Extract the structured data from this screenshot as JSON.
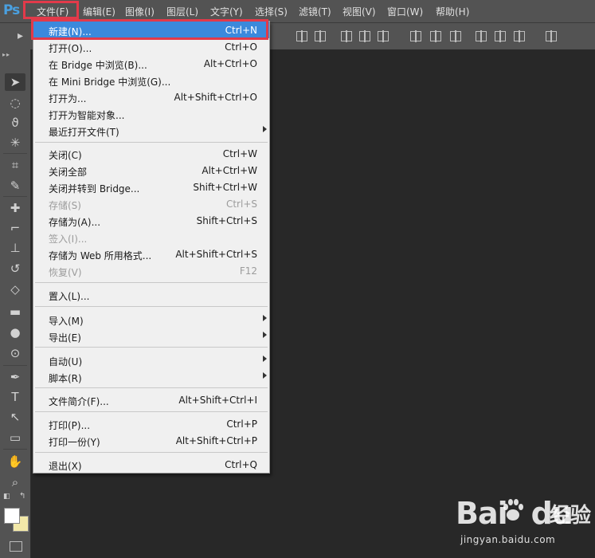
{
  "app": {
    "logo": "Ps"
  },
  "menubar": {
    "items": [
      {
        "label": "文件(F)"
      },
      {
        "label": "编辑(E)"
      },
      {
        "label": "图像(I)"
      },
      {
        "label": "图层(L)"
      },
      {
        "label": "文字(Y)"
      },
      {
        "label": "选择(S)"
      },
      {
        "label": "滤镜(T)"
      },
      {
        "label": "视图(V)"
      },
      {
        "label": "窗口(W)"
      },
      {
        "label": "帮助(H)"
      }
    ]
  },
  "file_menu": {
    "items": [
      {
        "label": "新建(N)...",
        "shortcut": "Ctrl+N",
        "highlighted": true
      },
      {
        "label": "打开(O)...",
        "shortcut": "Ctrl+O"
      },
      {
        "label": "在 Bridge 中浏览(B)...",
        "shortcut": "Alt+Ctrl+O"
      },
      {
        "label": "在 Mini Bridge 中浏览(G)...",
        "shortcut": ""
      },
      {
        "label": "打开为...",
        "shortcut": "Alt+Shift+Ctrl+O"
      },
      {
        "label": "打开为智能对象...",
        "shortcut": ""
      },
      {
        "label": "最近打开文件(T)",
        "shortcut": "",
        "submenu": true
      },
      {
        "label": "关闭(C)",
        "shortcut": "Ctrl+W"
      },
      {
        "label": "关闭全部",
        "shortcut": "Alt+Ctrl+W"
      },
      {
        "label": "关闭并转到 Bridge...",
        "shortcut": "Shift+Ctrl+W"
      },
      {
        "label": "存储(S)",
        "shortcut": "Ctrl+S",
        "disabled": true
      },
      {
        "label": "存储为(A)...",
        "shortcut": "Shift+Ctrl+S"
      },
      {
        "label": "签入(I)...",
        "shortcut": "",
        "disabled": true
      },
      {
        "label": "存储为 Web 所用格式...",
        "shortcut": "Alt+Shift+Ctrl+S"
      },
      {
        "label": "恢复(V)",
        "shortcut": "F12",
        "disabled": true
      },
      {
        "label": "置入(L)...",
        "shortcut": ""
      },
      {
        "label": "导入(M)",
        "shortcut": "",
        "submenu": true
      },
      {
        "label": "导出(E)",
        "shortcut": "",
        "submenu": true
      },
      {
        "label": "自动(U)",
        "shortcut": "",
        "submenu": true
      },
      {
        "label": "脚本(R)",
        "shortcut": "",
        "submenu": true
      },
      {
        "label": "文件简介(F)...",
        "shortcut": "Alt+Shift+Ctrl+I"
      },
      {
        "label": "打印(P)...",
        "shortcut": "Ctrl+P"
      },
      {
        "label": "打印一份(Y)",
        "shortcut": "Alt+Shift+Ctrl+P"
      },
      {
        "label": "退出(X)",
        "shortcut": "Ctrl+Q"
      }
    ]
  },
  "tools": [
    {
      "icon": "move-tool-icon"
    },
    {
      "icon": "elliptical-marquee-icon"
    },
    {
      "icon": "lasso-icon"
    },
    {
      "icon": "magic-wand-icon"
    },
    {
      "icon": "crop-icon"
    },
    {
      "icon": "eyedropper-icon"
    },
    {
      "icon": "healing-brush-icon"
    },
    {
      "icon": "brush-icon"
    },
    {
      "icon": "clone-stamp-icon"
    },
    {
      "icon": "history-brush-icon"
    },
    {
      "icon": "eraser-icon"
    },
    {
      "icon": "gradient-icon"
    },
    {
      "icon": "blur-icon"
    },
    {
      "icon": "dodge-icon"
    },
    {
      "icon": "pen-icon"
    },
    {
      "icon": "type-icon"
    },
    {
      "icon": "path-selection-icon"
    },
    {
      "icon": "rectangle-shape-icon"
    },
    {
      "icon": "hand-icon"
    },
    {
      "icon": "zoom-icon"
    }
  ],
  "colors": {
    "foreground": "#ffffff",
    "background": "#f2e8a8",
    "highlight": "#3b89dc",
    "annotation_red": "#e23a4a"
  },
  "watermark": {
    "brand": "Bai",
    "brand_suffix": "du",
    "sub": "经验",
    "url": "jingyan.baidu.com"
  }
}
